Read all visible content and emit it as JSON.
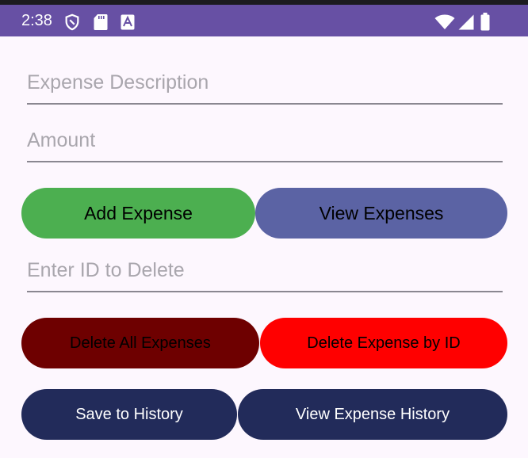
{
  "status_bar": {
    "time": "2:38",
    "icons": [
      "shield-icon",
      "sd-card-icon",
      "accessibility-icon",
      "wifi-icon",
      "cell-signal-icon",
      "battery-icon"
    ],
    "background_color": "#6750a4"
  },
  "form": {
    "description": {
      "placeholder": "Expense Description",
      "value": ""
    },
    "amount": {
      "placeholder": "Amount",
      "value": ""
    },
    "delete_id": {
      "placeholder": "Enter ID to Delete",
      "value": ""
    }
  },
  "buttons": {
    "add_expense": {
      "label": "Add Expense",
      "color": "#4caf50"
    },
    "view_expenses": {
      "label": "View Expenses",
      "color": "#5b63a4"
    },
    "delete_all": {
      "label": "Delete All Expenses",
      "color": "#6e0000"
    },
    "delete_by_id": {
      "label": "Delete Expense by ID",
      "color": "#ff0000"
    },
    "save_history": {
      "label": "Save to History",
      "color": "#222b5a"
    },
    "view_history": {
      "label": "View Expense History",
      "color": "#222b5a"
    }
  }
}
